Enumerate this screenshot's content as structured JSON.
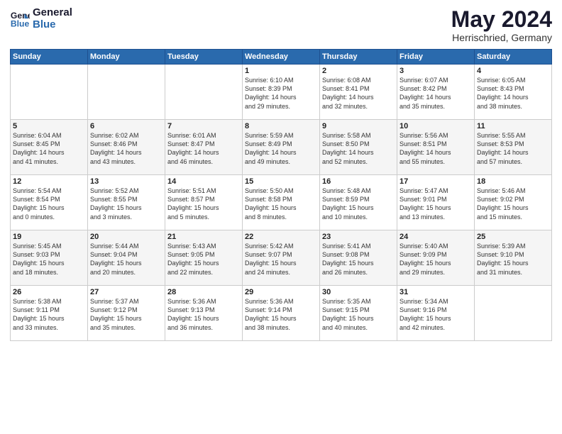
{
  "header": {
    "logo_line1": "General",
    "logo_line2": "Blue",
    "month": "May 2024",
    "location": "Herrischried, Germany"
  },
  "weekdays": [
    "Sunday",
    "Monday",
    "Tuesday",
    "Wednesday",
    "Thursday",
    "Friday",
    "Saturday"
  ],
  "weeks": [
    [
      {
        "day": "",
        "info": ""
      },
      {
        "day": "",
        "info": ""
      },
      {
        "day": "",
        "info": ""
      },
      {
        "day": "1",
        "info": "Sunrise: 6:10 AM\nSunset: 8:39 PM\nDaylight: 14 hours\nand 29 minutes."
      },
      {
        "day": "2",
        "info": "Sunrise: 6:08 AM\nSunset: 8:41 PM\nDaylight: 14 hours\nand 32 minutes."
      },
      {
        "day": "3",
        "info": "Sunrise: 6:07 AM\nSunset: 8:42 PM\nDaylight: 14 hours\nand 35 minutes."
      },
      {
        "day": "4",
        "info": "Sunrise: 6:05 AM\nSunset: 8:43 PM\nDaylight: 14 hours\nand 38 minutes."
      }
    ],
    [
      {
        "day": "5",
        "info": "Sunrise: 6:04 AM\nSunset: 8:45 PM\nDaylight: 14 hours\nand 41 minutes."
      },
      {
        "day": "6",
        "info": "Sunrise: 6:02 AM\nSunset: 8:46 PM\nDaylight: 14 hours\nand 43 minutes."
      },
      {
        "day": "7",
        "info": "Sunrise: 6:01 AM\nSunset: 8:47 PM\nDaylight: 14 hours\nand 46 minutes."
      },
      {
        "day": "8",
        "info": "Sunrise: 5:59 AM\nSunset: 8:49 PM\nDaylight: 14 hours\nand 49 minutes."
      },
      {
        "day": "9",
        "info": "Sunrise: 5:58 AM\nSunset: 8:50 PM\nDaylight: 14 hours\nand 52 minutes."
      },
      {
        "day": "10",
        "info": "Sunrise: 5:56 AM\nSunset: 8:51 PM\nDaylight: 14 hours\nand 55 minutes."
      },
      {
        "day": "11",
        "info": "Sunrise: 5:55 AM\nSunset: 8:53 PM\nDaylight: 14 hours\nand 57 minutes."
      }
    ],
    [
      {
        "day": "12",
        "info": "Sunrise: 5:54 AM\nSunset: 8:54 PM\nDaylight: 15 hours\nand 0 minutes."
      },
      {
        "day": "13",
        "info": "Sunrise: 5:52 AM\nSunset: 8:55 PM\nDaylight: 15 hours\nand 3 minutes."
      },
      {
        "day": "14",
        "info": "Sunrise: 5:51 AM\nSunset: 8:57 PM\nDaylight: 15 hours\nand 5 minutes."
      },
      {
        "day": "15",
        "info": "Sunrise: 5:50 AM\nSunset: 8:58 PM\nDaylight: 15 hours\nand 8 minutes."
      },
      {
        "day": "16",
        "info": "Sunrise: 5:48 AM\nSunset: 8:59 PM\nDaylight: 15 hours\nand 10 minutes."
      },
      {
        "day": "17",
        "info": "Sunrise: 5:47 AM\nSunset: 9:01 PM\nDaylight: 15 hours\nand 13 minutes."
      },
      {
        "day": "18",
        "info": "Sunrise: 5:46 AM\nSunset: 9:02 PM\nDaylight: 15 hours\nand 15 minutes."
      }
    ],
    [
      {
        "day": "19",
        "info": "Sunrise: 5:45 AM\nSunset: 9:03 PM\nDaylight: 15 hours\nand 18 minutes."
      },
      {
        "day": "20",
        "info": "Sunrise: 5:44 AM\nSunset: 9:04 PM\nDaylight: 15 hours\nand 20 minutes."
      },
      {
        "day": "21",
        "info": "Sunrise: 5:43 AM\nSunset: 9:05 PM\nDaylight: 15 hours\nand 22 minutes."
      },
      {
        "day": "22",
        "info": "Sunrise: 5:42 AM\nSunset: 9:07 PM\nDaylight: 15 hours\nand 24 minutes."
      },
      {
        "day": "23",
        "info": "Sunrise: 5:41 AM\nSunset: 9:08 PM\nDaylight: 15 hours\nand 26 minutes."
      },
      {
        "day": "24",
        "info": "Sunrise: 5:40 AM\nSunset: 9:09 PM\nDaylight: 15 hours\nand 29 minutes."
      },
      {
        "day": "25",
        "info": "Sunrise: 5:39 AM\nSunset: 9:10 PM\nDaylight: 15 hours\nand 31 minutes."
      }
    ],
    [
      {
        "day": "26",
        "info": "Sunrise: 5:38 AM\nSunset: 9:11 PM\nDaylight: 15 hours\nand 33 minutes."
      },
      {
        "day": "27",
        "info": "Sunrise: 5:37 AM\nSunset: 9:12 PM\nDaylight: 15 hours\nand 35 minutes."
      },
      {
        "day": "28",
        "info": "Sunrise: 5:36 AM\nSunset: 9:13 PM\nDaylight: 15 hours\nand 36 minutes."
      },
      {
        "day": "29",
        "info": "Sunrise: 5:36 AM\nSunset: 9:14 PM\nDaylight: 15 hours\nand 38 minutes."
      },
      {
        "day": "30",
        "info": "Sunrise: 5:35 AM\nSunset: 9:15 PM\nDaylight: 15 hours\nand 40 minutes."
      },
      {
        "day": "31",
        "info": "Sunrise: 5:34 AM\nSunset: 9:16 PM\nDaylight: 15 hours\nand 42 minutes."
      },
      {
        "day": "",
        "info": ""
      }
    ]
  ]
}
